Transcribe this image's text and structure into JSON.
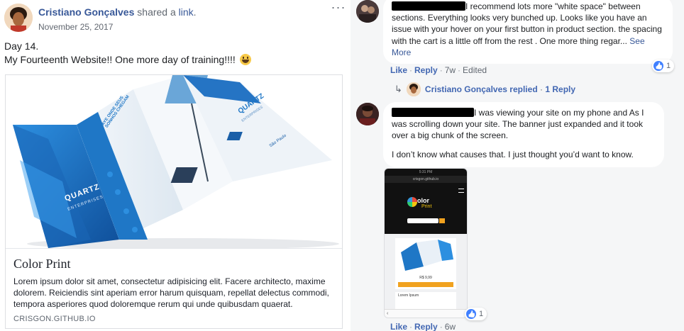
{
  "post": {
    "author": "Cristiano Gonçalves",
    "verb": "shared a",
    "link_word": "link",
    "period": ".",
    "date": "November 25, 2017",
    "more": "···",
    "text_line1": "Day 14.",
    "text_line2": "My Fourteenth Website!! One more day of training!!!!",
    "emoji": "grinning-face-emoji",
    "card": {
      "title": "Color Print",
      "description": "Lorem ipsum dolor sit amet, consectetur adipisicing elit. Facere architecto, maxime dolorem. Reiciendis sint aperiam error harum quisquam, repellat delectus commodi, tempora asperiores quod doloremque rerum qui unde quibusdam quaerat.",
      "domain": "CRISGON.GITHUB.IO",
      "image_text": {
        "brand": "QUARTZ",
        "brand_sub": "ENTERPRISES",
        "panel_text": "AYE ONDE SEUS SONHOS CHEGAM",
        "brand_panel": "QUARTZ",
        "brand_panel_sub": "ENTERPRISES",
        "tower_caption": "São Paulo"
      }
    }
  },
  "comments": [
    {
      "text": "I recommend lots more \"white space\" between sections. Everything looks very bunched up. Looks like you have an issue with your hover on your first button in product section. the spacing with the cart is a little off from the rest . One more thing regar...",
      "see_more": "See More",
      "actions": {
        "like": "Like",
        "reply": "Reply",
        "time": "7w",
        "edited": "Edited"
      },
      "reactions": "1",
      "replies": {
        "name": "Cristiano Gonçalves",
        "verb": "replied",
        "dot": "·",
        "count": "1 Reply"
      }
    },
    {
      "text_p1": "I was viewing your site on my phone and As I was scrolling down your site. The banner just expanded and it took over a big chunk of the screen.",
      "text_p2": "I don’t know what causes that. I just thought you’d want to know.",
      "reactions": "1",
      "actions": {
        "like": "Like",
        "reply": "Reply",
        "time": "6w"
      },
      "screenshot": {
        "status_time": "5:31 PM",
        "url": "crisgon.github.io",
        "logo_word1": "olor",
        "logo_word2": "Print",
        "price": "R$ 9,99",
        "product_label": "Lorem Ipsum"
      }
    }
  ],
  "colors": {
    "link_blue": "#385898",
    "action_blue": "#4267b2",
    "bubble": "#f2f3f5",
    "panel_bg": "#f5f6f7",
    "brochure_blue": "#1f77c6"
  }
}
